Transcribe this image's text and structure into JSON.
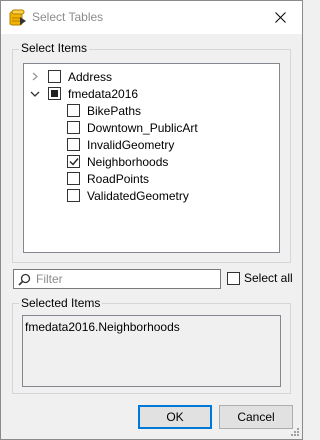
{
  "window": {
    "title": "Select Tables",
    "app_icon": "fme-table-icon",
    "close_icon": "close-icon"
  },
  "select_items": {
    "group_label": "Select Items",
    "tree": [
      {
        "label": "Address",
        "checked": false,
        "expander": "collapsed",
        "level": 0
      },
      {
        "label": "fmedata2016",
        "checked": "partial",
        "expander": "expanded",
        "level": 0
      },
      {
        "label": "BikePaths",
        "checked": false,
        "level": 1
      },
      {
        "label": "Downtown_PublicArt",
        "checked": false,
        "level": 1
      },
      {
        "label": "InvalidGeometry",
        "checked": false,
        "level": 1
      },
      {
        "label": "Neighborhoods",
        "checked": true,
        "level": 1
      },
      {
        "label": "RoadPoints",
        "checked": false,
        "level": 1
      },
      {
        "label": "ValidatedGeometry",
        "checked": false,
        "level": 1
      }
    ]
  },
  "filter": {
    "placeholder": "Filter",
    "value": "",
    "icon": "search-icon"
  },
  "select_all": {
    "label": "Select all",
    "checked": false
  },
  "selected_items": {
    "group_label": "Selected Items",
    "items": [
      "fmedata2016.Neighborhoods"
    ]
  },
  "buttons": {
    "ok": "OK",
    "cancel": "Cancel"
  }
}
